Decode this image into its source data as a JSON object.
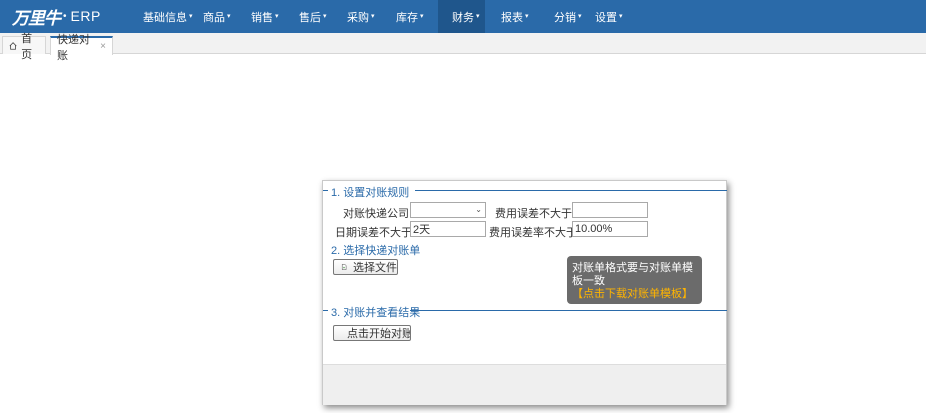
{
  "header": {
    "logo_text": "万里牛",
    "logo_dot": "•",
    "logo_erp": "ERP",
    "nav": [
      {
        "label": "基础信息",
        "active": false
      },
      {
        "label": "商品",
        "active": false
      },
      {
        "label": "销售",
        "active": false
      },
      {
        "label": "售后",
        "active": false
      },
      {
        "label": "采购",
        "active": false
      },
      {
        "label": "库存",
        "active": false
      },
      {
        "label": "财务",
        "active": true
      },
      {
        "label": "报表",
        "active": false
      },
      {
        "label": "分销",
        "active": false
      },
      {
        "label": "设置",
        "active": false
      }
    ],
    "caret": "▾",
    "colors": {
      "bar": "#2a6aa9",
      "active": "#1f568c"
    }
  },
  "tabs": {
    "home_label": "首页",
    "active_label": "快递对账",
    "close_glyph": "×"
  },
  "dialog": {
    "section1_title": "1. 设置对账规则",
    "express_company_label": "对账快递公司:",
    "express_company_value": "",
    "fee_error_label": "费用误差不大于:",
    "fee_error_value": "",
    "date_error_label": "日期误差不大于:",
    "date_error_value": "2天",
    "fee_rate_label": "费用误差率不大于:",
    "fee_rate_value": "10.00%",
    "section2_title": "2. 选择快递对账单",
    "choose_file_label": "选择文件",
    "tooltip_text": "对账单格式要与对账单模板一致",
    "tooltip_link": "【点击下载对账单模板】",
    "section3_title": "3. 对账并查看结果",
    "start_label": "点击开始对账",
    "select_arrow": "⌄"
  }
}
